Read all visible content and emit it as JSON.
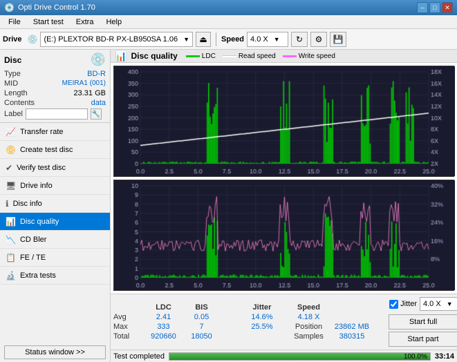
{
  "titleBar": {
    "title": "Opti Drive Control 1.70",
    "icon": "💿",
    "minimize": "–",
    "maximize": "□",
    "close": "✕"
  },
  "menuBar": {
    "items": [
      "File",
      "Start test",
      "Extra",
      "Help"
    ]
  },
  "toolbar": {
    "driveLabel": "Drive",
    "driveText": "(E:)  PLEXTOR BD-R  PX-LB950SA 1.06",
    "speedLabel": "Speed",
    "speedValue": "4.0 X"
  },
  "disc": {
    "title": "Disc",
    "typeLabel": "Type",
    "typeValue": "BD-R",
    "midLabel": "MID",
    "midValue": "MEIRA1 (001)",
    "lengthLabel": "Length",
    "lengthValue": "23.31 GB",
    "contentsLabel": "Contents",
    "contentsValue": "data",
    "labelLabel": "Label",
    "labelValue": ""
  },
  "navItems": [
    {
      "id": "transfer-rate",
      "label": "Transfer rate"
    },
    {
      "id": "create-test-disc",
      "label": "Create test disc"
    },
    {
      "id": "verify-test-disc",
      "label": "Verify test disc"
    },
    {
      "id": "drive-info",
      "label": "Drive info"
    },
    {
      "id": "disc-info",
      "label": "Disc info"
    },
    {
      "id": "disc-quality",
      "label": "Disc quality",
      "active": true
    },
    {
      "id": "cd-bler",
      "label": "CD Bler"
    },
    {
      "id": "fe-te",
      "label": "FE / TE"
    },
    {
      "id": "extra-tests",
      "label": "Extra tests"
    }
  ],
  "statusBtn": "Status window >>",
  "chartTitle": "Disc quality",
  "legend": {
    "ldc": {
      "label": "LDC",
      "color": "#00aa00"
    },
    "readSpeed": {
      "label": "Read speed",
      "color": "#ffffff"
    },
    "writeSpeed": {
      "label": "Write speed",
      "color": "#ff66ff"
    },
    "bis": {
      "label": "BIS",
      "color": "#0088ff"
    },
    "jitter": {
      "label": "Jitter",
      "color": "#ff66ff"
    }
  },
  "topChart": {
    "yMax": 400,
    "yLabels": [
      "400",
      "350",
      "300",
      "250",
      "200",
      "150",
      "100",
      "50",
      "0"
    ],
    "yRight": [
      "18X",
      "16X",
      "14X",
      "12X",
      "10X",
      "8X",
      "6X",
      "4X",
      "2X"
    ],
    "xMax": 25.0,
    "xLabels": [
      "0.0",
      "2.5",
      "5.0",
      "7.5",
      "10.0",
      "12.5",
      "15.0",
      "17.5",
      "20.0",
      "22.5",
      "25.0"
    ]
  },
  "bottomChart": {
    "yMax": 10,
    "yLabels": [
      "10",
      "9",
      "8",
      "7",
      "6",
      "5",
      "4",
      "3",
      "2",
      "1"
    ],
    "yRight": [
      "40%",
      "32%",
      "24%",
      "16%",
      "8%"
    ],
    "xMax": 25.0,
    "xLabels": [
      "0.0",
      "2.5",
      "5.0",
      "7.5",
      "10.0",
      "12.5",
      "15.0",
      "17.5",
      "20.0",
      "22.5",
      "25.0"
    ]
  },
  "stats": {
    "headers": [
      "",
      "LDC",
      "BIS",
      "",
      "Jitter",
      "Speed",
      ""
    ],
    "avg": {
      "label": "Avg",
      "ldc": "2.41",
      "bis": "0.05",
      "jitter": "14.6%",
      "speed": "4.18 X"
    },
    "max": {
      "label": "Max",
      "ldc": "333",
      "bis": "7",
      "jitter": "25.5%"
    },
    "total": {
      "label": "Total",
      "ldc": "920660",
      "bis": "18050"
    },
    "position": {
      "label": "Position",
      "value": "23862 MB"
    },
    "samples": {
      "label": "Samples",
      "value": "380315"
    },
    "speedSelect": "4.0 X",
    "jitterCheck": true,
    "startFull": "Start full",
    "startPart": "Start part"
  },
  "statusBar": {
    "text": "Test completed",
    "progress": 100,
    "progressLabel": "100.0%",
    "time": "33:14"
  }
}
